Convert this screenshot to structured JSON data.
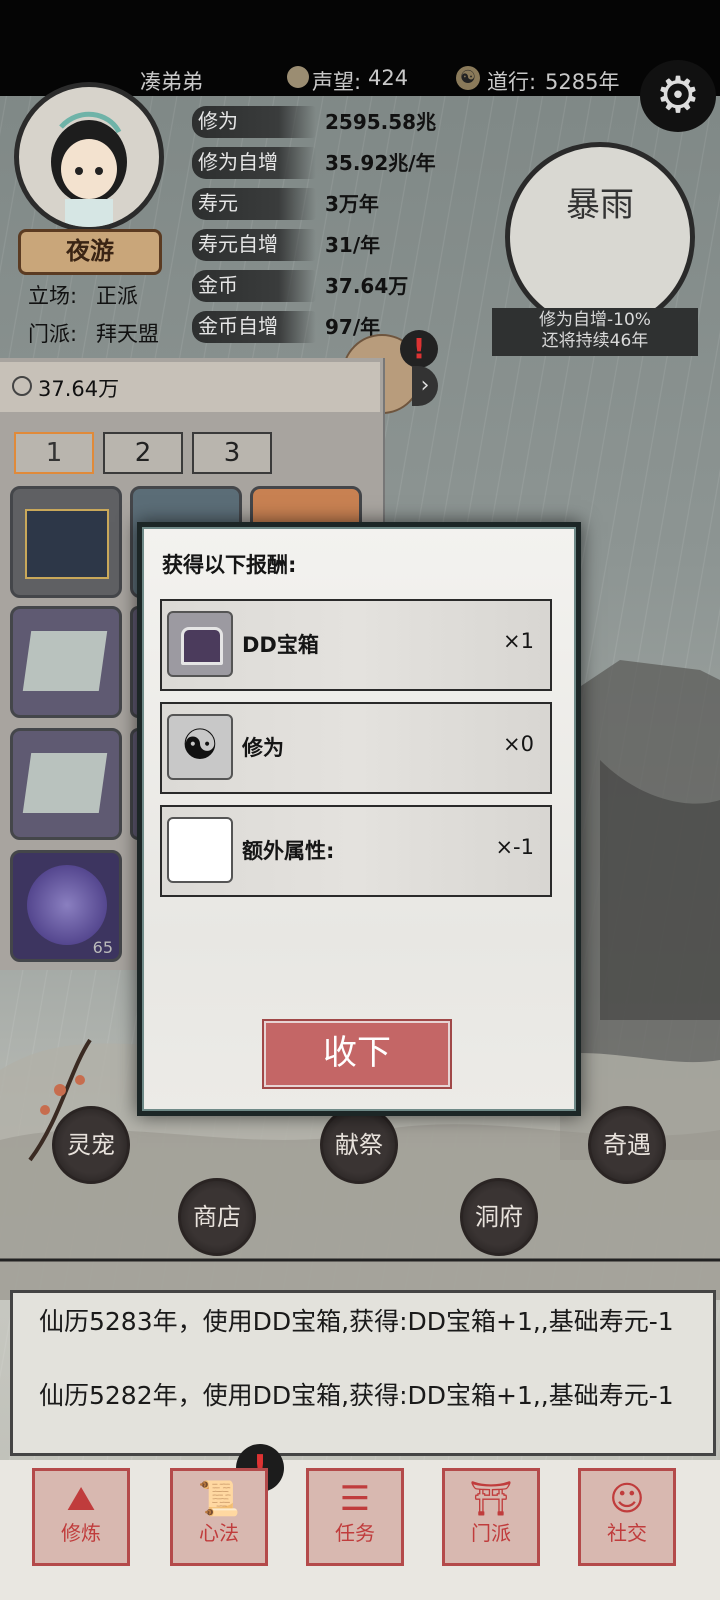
{
  "colors": {
    "accent_button": "#c46666",
    "dialog_bg": "#efeeea",
    "top_bar": "#050505",
    "nav_red": "#c03c3c"
  },
  "header": {
    "player_name": "凑弟弟",
    "reputation_label": "声望:",
    "reputation_value": "424",
    "daoxing_label": "道行:",
    "daoxing_value": "5285年"
  },
  "profile": {
    "title_badge": "夜游",
    "stance_label": "立场:",
    "stance_value": "正派",
    "sect_label": "门派:",
    "sect_value": "拜天盟"
  },
  "stats": [
    {
      "label": "修为",
      "value": "2595.58兆"
    },
    {
      "label": "修为自增",
      "value": "35.92兆/年"
    },
    {
      "label": "寿元",
      "value": "3万年"
    },
    {
      "label": "寿元自增",
      "value": "31/年"
    },
    {
      "label": "金币",
      "value": "37.64万"
    },
    {
      "label": "金币自增",
      "value": "97/年"
    }
  ],
  "weather": {
    "name": "暴雨",
    "effect": "修为自增-10%",
    "duration": "还将持续46年"
  },
  "inventory": {
    "coins": "37.64万",
    "tabs": [
      "1",
      "2",
      "3"
    ],
    "active_tab": "1",
    "slot_count_badge": "65"
  },
  "reward_dialog": {
    "title": "获得以下报酬:",
    "items": [
      {
        "name": "DD宝箱",
        "qty": "×1",
        "icon": "treasure-chest-icon"
      },
      {
        "name": "修为",
        "qty": "×0",
        "icon": "yin-yang-icon"
      },
      {
        "name": "额外属性:",
        "qty": "×-1",
        "icon": "blank-icon"
      }
    ],
    "accept_label": "收下"
  },
  "map_buttons": {
    "spirit_pet": "灵宠",
    "sacrifice": "献祭",
    "encounter": "奇遇",
    "shop": "商店",
    "cave": "洞府"
  },
  "log": {
    "lines": [
      "仙历5283年，使用DD宝箱,获得:DD宝箱+1,,基础寿元-1",
      "仙历5282年，使用DD宝箱,获得:DD宝箱+1,,基础寿元-1"
    ]
  },
  "nav": [
    {
      "label": "修炼"
    },
    {
      "label": "心法"
    },
    {
      "label": "任务"
    },
    {
      "label": "门派"
    },
    {
      "label": "社交"
    }
  ],
  "alert_mark": "!"
}
